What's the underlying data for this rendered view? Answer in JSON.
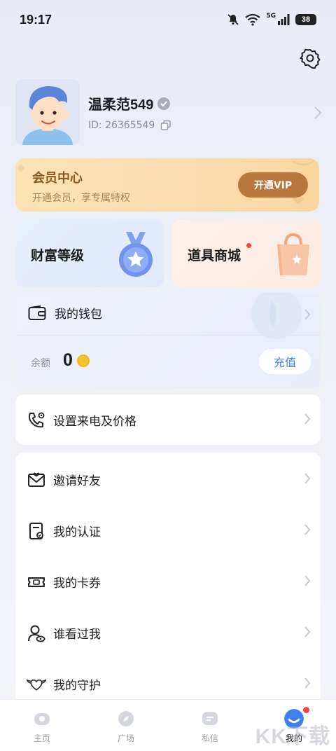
{
  "status_bar": {
    "time": "19:17",
    "network": "5G",
    "battery": "38"
  },
  "profile": {
    "name": "温柔范549",
    "id_text": "ID: 26365549"
  },
  "vip": {
    "title": "会员中心",
    "subtitle": "开通会员，享专属特权",
    "button_label": "开通VIP"
  },
  "tiles": {
    "wealth_label": "财富等级",
    "shop_label": "道具商城"
  },
  "wallet": {
    "title": "我的钱包",
    "balance_label": "余额",
    "balance_value": "0",
    "recharge_label": "充值"
  },
  "price_item": {
    "label": "设置来电及价格"
  },
  "menu": {
    "items": [
      {
        "label": "邀请好友",
        "icon": "invite-envelope-icon"
      },
      {
        "label": "我的认证",
        "icon": "certification-icon"
      },
      {
        "label": "我的卡券",
        "icon": "coupon-icon"
      },
      {
        "label": "谁看过我",
        "icon": "visitors-icon"
      },
      {
        "label": "我的守护",
        "icon": "guard-heart-icon"
      }
    ]
  },
  "tabbar": {
    "tabs": [
      {
        "label": "主页",
        "icon": "home-icon",
        "active": false
      },
      {
        "label": "广场",
        "icon": "compass-icon",
        "active": false
      },
      {
        "label": "私信",
        "icon": "message-icon",
        "active": false
      },
      {
        "label": "我的",
        "icon": "profile-icon",
        "active": true
      }
    ]
  },
  "watermark": "KK下载",
  "colors": {
    "accent_blue": "#4a83e6",
    "vip_button": "#b7773d",
    "notification_dot": "#f0463c"
  }
}
